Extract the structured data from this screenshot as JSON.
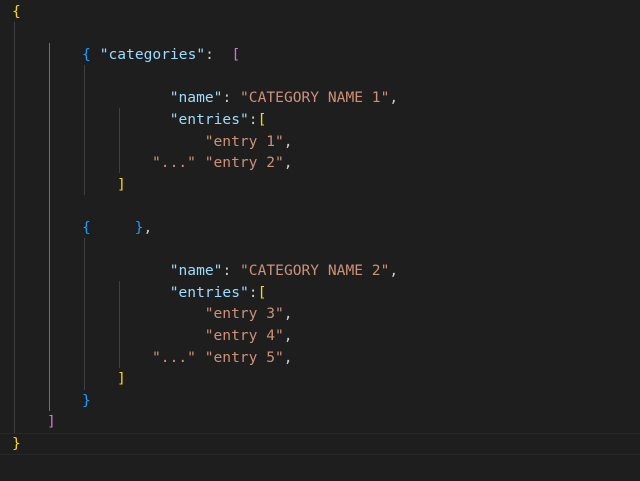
{
  "editor": {
    "theme_colors": {
      "background": "#1e1e1e",
      "key": "#9cdcfe",
      "string": "#ce9178",
      "punctuation": "#cccccc",
      "bracket_level1": "#ffd700",
      "bracket_level2": "#da70d6",
      "bracket_level3": "#179fff"
    },
    "tokens": {
      "open_root": "{",
      "categories_key": "\"categories\"",
      "colon_wide": ":  ",
      "open_array": "[",
      "open_object": "{",
      "name_key": "\"name\"",
      "colon": ": ",
      "comma": ",",
      "category_1": "\"CATEGORY NAME 1\"",
      "category_2": "\"CATEGORY NAME 2\"",
      "entries_key": "\"entries\"",
      "colon_tight": ":",
      "entry_1": "\"entry 1\"",
      "entry_2": "\"entry 2\"",
      "entry_3": "\"entry 3\"",
      "entry_4": "\"entry 4\"",
      "entry_5": "\"entry 5\"",
      "ellipsis": "\"...\"",
      "close_entries": "]",
      "close_object": "}",
      "close_object_comma": "},",
      "close_array": "]",
      "close_root": "}"
    }
  }
}
